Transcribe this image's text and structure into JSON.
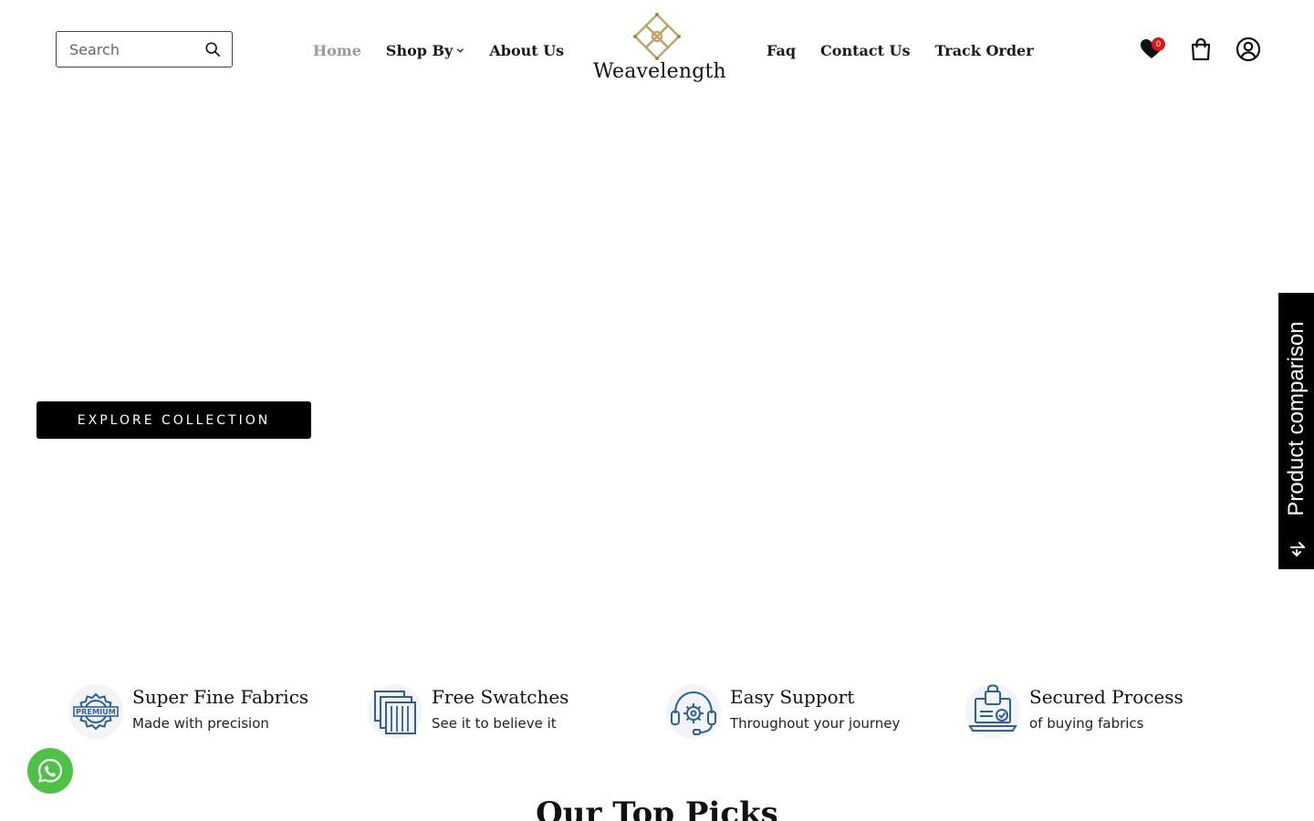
{
  "header": {
    "search": {
      "placeholder": "Search",
      "value": ""
    },
    "nav_left": [
      "Home",
      "Shop By",
      "About Us"
    ],
    "nav_right": [
      "Faq",
      "Contact Us",
      "Track Order"
    ],
    "active_nav": "Home",
    "brand": "Weavelength",
    "wishlist_count": "0",
    "icons": [
      "search-icon",
      "heart-icon",
      "bag-icon",
      "account-icon",
      "chevron-down-icon"
    ]
  },
  "hero": {
    "cta_label": "EXPLORE COLLECTION"
  },
  "compare_tab": {
    "label": "Product comparison",
    "icon": "compare-arrows-icon"
  },
  "features": [
    {
      "title": "Super Fine Fabrics",
      "subtitle": "Made with precision",
      "icon": "premium-badge-icon",
      "badge_text": "PREMIUM"
    },
    {
      "title": "Free Swatches",
      "subtitle": "See it to believe it",
      "icon": "swatches-icon"
    },
    {
      "title": "Easy Support",
      "subtitle": "Throughout your journey",
      "icon": "support-headset-icon"
    },
    {
      "title": "Secured Process",
      "subtitle": "of buying fabrics",
      "icon": "secure-laptop-icon"
    }
  ],
  "section": {
    "title": "Our Top Picks"
  },
  "colors": {
    "accent_dark": "#000000",
    "nav_active": "#9a9a9a",
    "logo_gold": "#c2a46a",
    "feature_icon_blue": "#2f5f9a",
    "badge_red": "#e01515",
    "whatsapp_green": "#4dc247"
  }
}
